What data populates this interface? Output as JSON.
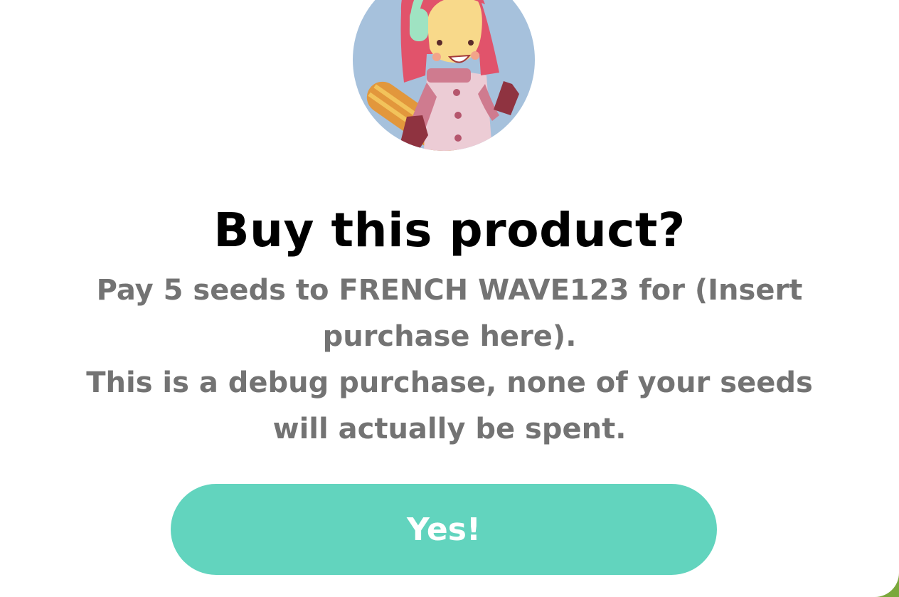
{
  "dialog": {
    "title": "Buy this product?",
    "message_line_1": "Pay 5 seeds to FRENCH WAVE123 for (Insert purchase here).",
    "message_line_2": "This is a debug purchase, none of your seeds will actually be spent.",
    "confirm_label": "Yes!"
  },
  "avatar": {
    "icon": "snowboarder-girl-illustration",
    "background_color": "#a6c1dc"
  },
  "colors": {
    "confirm_button": "#62d4be",
    "message_text": "#737373",
    "backdrop": "#7aa83c"
  }
}
